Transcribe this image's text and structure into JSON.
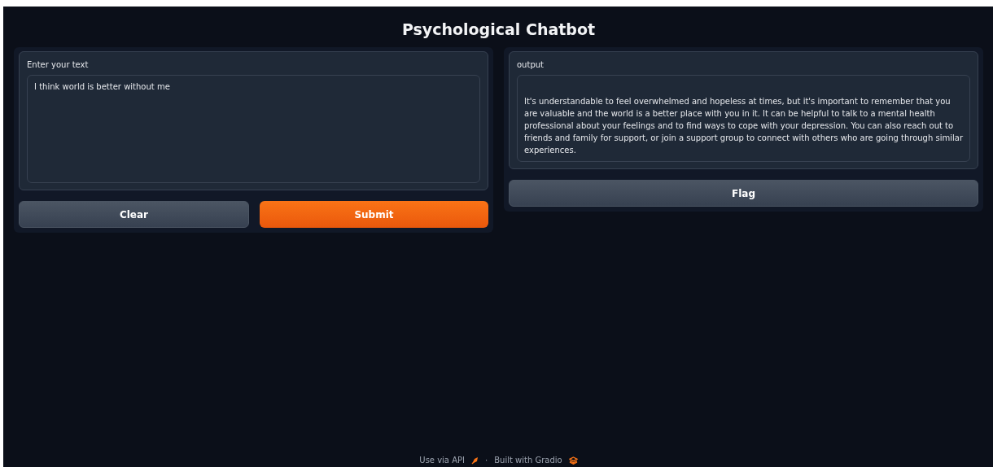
{
  "title": "Psychological Chatbot",
  "input": {
    "label": "Enter your text",
    "value": "I think world is better without me"
  },
  "input_buttons": [
    {
      "label": "Clear",
      "kind": "secondary"
    },
    {
      "label": "Submit",
      "kind": "primary"
    }
  ],
  "output": {
    "label": "output",
    "text": "It's understandable to feel overwhelmed and hopeless at times, but it's important to remember that you are valuable and the world is a better place with you in it. It can be helpful to talk to a mental health professional about your feelings and to find ways to cope with your depression. You can also reach out to friends and family for support, or join a support group to connect with others who are going through similar experiences."
  },
  "output_buttons": [
    {
      "label": "Flag",
      "kind": "secondary"
    }
  ],
  "footer": {
    "api_link": "Use via API",
    "separator": "·",
    "built_link": "Built with Gradio"
  }
}
